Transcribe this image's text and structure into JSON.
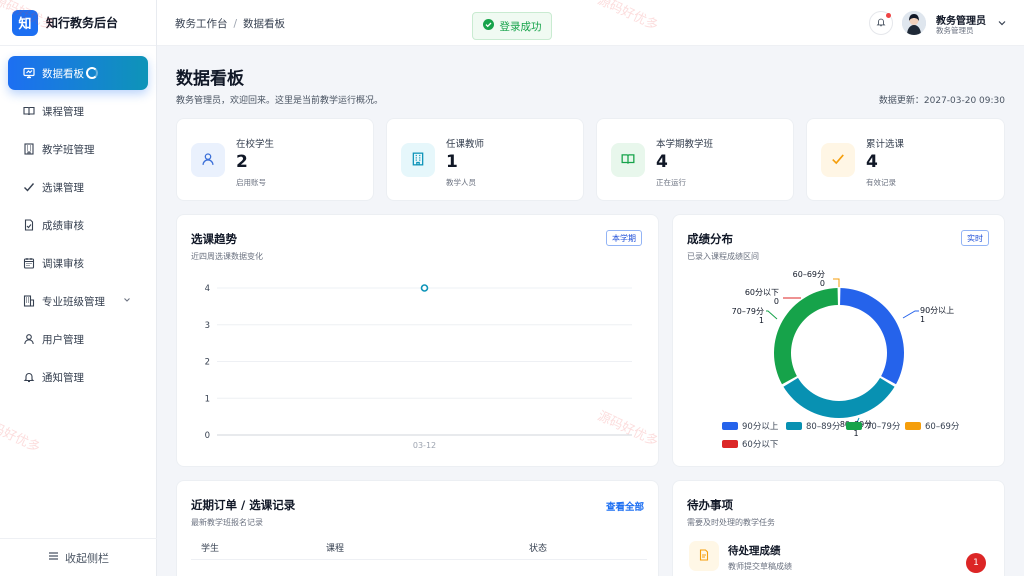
{
  "brand": {
    "logo_text": "知",
    "title": "知行教务后台"
  },
  "sidebar": {
    "items": [
      {
        "label": "数据看板",
        "icon": "dashboard-icon"
      },
      {
        "label": "课程管理",
        "icon": "book-icon"
      },
      {
        "label": "教学班管理",
        "icon": "building-icon"
      },
      {
        "label": "选课管理",
        "icon": "check-icon"
      },
      {
        "label": "成绩审核",
        "icon": "document-check-icon"
      },
      {
        "label": "调课审核",
        "icon": "calendar-icon"
      },
      {
        "label": "专业班级管理",
        "icon": "org-icon"
      },
      {
        "label": "用户管理",
        "icon": "user-icon"
      },
      {
        "label": "通知管理",
        "icon": "bell-icon"
      }
    ],
    "collapse_label": "收起侧栏"
  },
  "header": {
    "breadcrumb": [
      "教务工作台",
      "数据看板"
    ],
    "breadcrumb_sep": "/",
    "toast": "登录成功",
    "user_name": "教务管理员",
    "user_role": "教务管理员"
  },
  "page": {
    "title": "数据看板",
    "subtitle": "教务管理员，欢迎回来。这里是当前教学运行概况。",
    "updated": "数据更新：2027-03-20 09:30"
  },
  "stats": [
    {
      "label": "在校学生",
      "value": "2",
      "sub": "启用账号",
      "color": "#3b6fd8",
      "bg": "#eaf1fd"
    },
    {
      "label": "任课教师",
      "value": "1",
      "sub": "教学人员",
      "color": "#0e94b8",
      "bg": "#e6f7fb"
    },
    {
      "label": "本学期教学班",
      "value": "4",
      "sub": "正在运行",
      "color": "#16a34a",
      "bg": "#e8f7ec"
    },
    {
      "label": "累计选课",
      "value": "4",
      "sub": "有效记录",
      "color": "#f59e0b",
      "bg": "#fff6e5"
    }
  ],
  "trend": {
    "title": "选课趋势",
    "subtitle": "近四周选课数据变化",
    "badge": "本学期"
  },
  "dist": {
    "title": "成绩分布",
    "subtitle": "已录入课程成绩区间",
    "badge": "实时"
  },
  "chart_data": [
    {
      "type": "line",
      "x": [
        "03-12"
      ],
      "series": [
        {
          "values": [
            4
          ]
        }
      ],
      "ylim": [
        0,
        4
      ],
      "yticks": [
        0,
        1,
        2,
        3,
        4
      ],
      "grid": true
    },
    {
      "type": "pie",
      "categories": [
        "90分以上",
        "80–89分",
        "70–79分",
        "60–69分",
        "60分以下"
      ],
      "values": [
        1,
        1,
        1,
        0,
        0
      ],
      "colors": [
        "#2563eb",
        "#0891b2",
        "#16a34a",
        "#f59e0b",
        "#dc2626"
      ],
      "donut": true,
      "legend": "bottom"
    }
  ],
  "orders": {
    "title": "近期订单 / 选课记录",
    "subtitle": "最新教学班报名记录",
    "link": "查看全部",
    "columns": [
      "学生",
      "课程",
      "状态"
    ]
  },
  "todo": {
    "title": "待办事项",
    "subtitle": "需要及时处理的教学任务",
    "items": [
      {
        "title": "待处理成绩",
        "sub": "教师提交草稿成绩",
        "count": "1"
      }
    ]
  },
  "watermark": "源码好优多"
}
